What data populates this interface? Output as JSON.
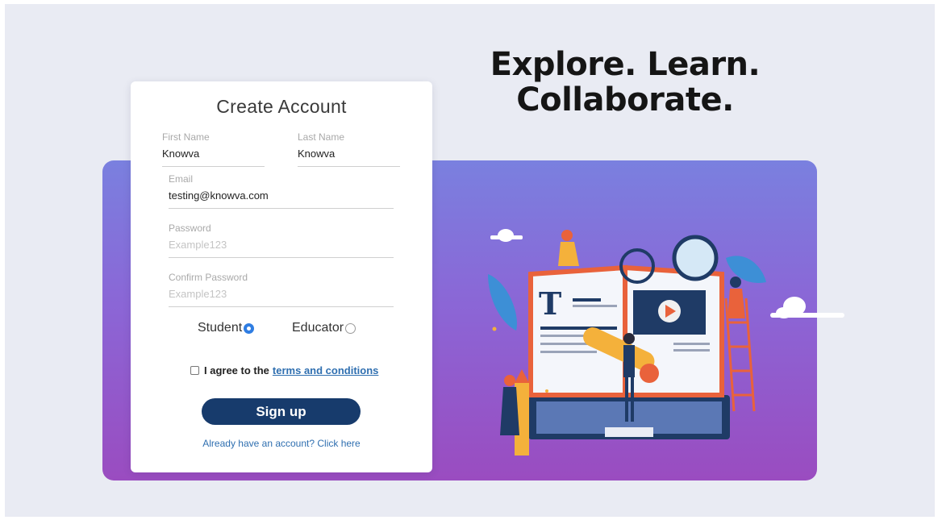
{
  "tagline": {
    "line1": "Explore. Learn.",
    "line2": "Collaborate."
  },
  "form": {
    "title": "Create Account",
    "first_name": {
      "label": "First Name",
      "value": "Knowva"
    },
    "last_name": {
      "label": "Last Name",
      "value": "Knowva"
    },
    "email": {
      "label": "Email",
      "value": "testing@knowva.com"
    },
    "password": {
      "label": "Password",
      "placeholder": "Example123"
    },
    "confirm_password": {
      "label": "Confirm Password",
      "placeholder": "Example123"
    },
    "roles": [
      {
        "label": "Student",
        "selected": true
      },
      {
        "label": "Educator",
        "selected": false
      }
    ],
    "agree_text": "I agree to the",
    "terms_link": "terms and conditions",
    "agree_checked": false,
    "submit_label": "Sign up",
    "login_link": "Already have an account? Click here"
  },
  "illustration": {
    "name": "education-laptop-illustration",
    "icon": "play-icon"
  },
  "colors": {
    "page_bg": "#e9ebf3",
    "gradient_top": "#7a80df",
    "gradient_bottom": "#9a4cc0",
    "button": "#173b6c",
    "link": "#2f6fb0",
    "radio_selected": "#2f7de2"
  }
}
